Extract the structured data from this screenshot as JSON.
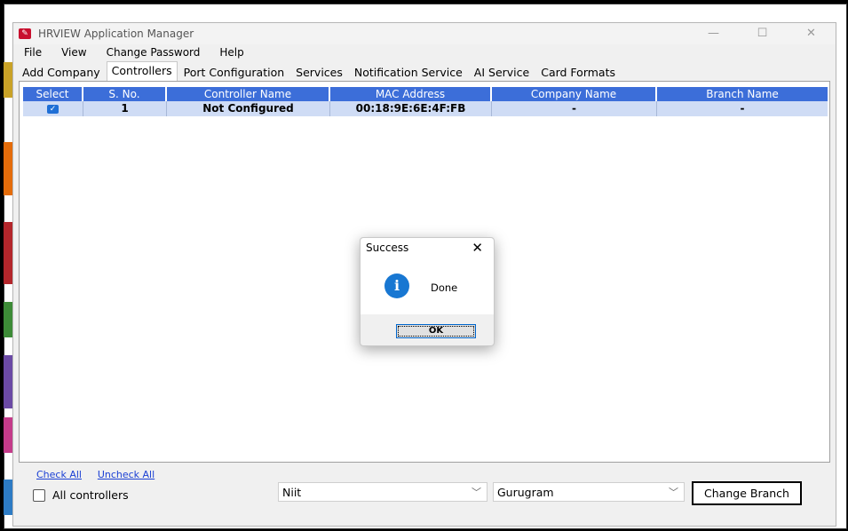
{
  "window": {
    "title": "HRVIEW Application Manager",
    "minimize": "—",
    "maximize": "☐",
    "close": "✕"
  },
  "menu": [
    "File",
    "View",
    "Change Password",
    "Help"
  ],
  "tabs": [
    "Add Company",
    "Controllers",
    "Port Configuration",
    "Services",
    "Notification Service",
    "AI Service",
    "Card Formats"
  ],
  "active_tab": "Controllers",
  "grid": {
    "columns": [
      "Select",
      "S. No.",
      "Controller Name",
      "MAC Address",
      "Company Name",
      "Branch Name"
    ],
    "rows": [
      {
        "selected": true,
        "sno": "1",
        "controller": "Not Configured",
        "mac": "00:18:9E:6E:4F:FB",
        "company": "-",
        "branch": "-"
      }
    ]
  },
  "links": {
    "check_all": "Check All",
    "uncheck_all": "Uncheck All"
  },
  "all_controllers_label": "All controllers",
  "company_combo": "Niit",
  "branch_combo": "Gurugram",
  "change_branch_button": "Change Branch",
  "dialog": {
    "title": "Success",
    "message": "Done",
    "ok": "OK"
  },
  "colors": {
    "header_blue": "#3c6ed9",
    "row_selected": "#cfdcf5",
    "info_blue": "#1877d2",
    "brand_red": "#c8102e"
  }
}
